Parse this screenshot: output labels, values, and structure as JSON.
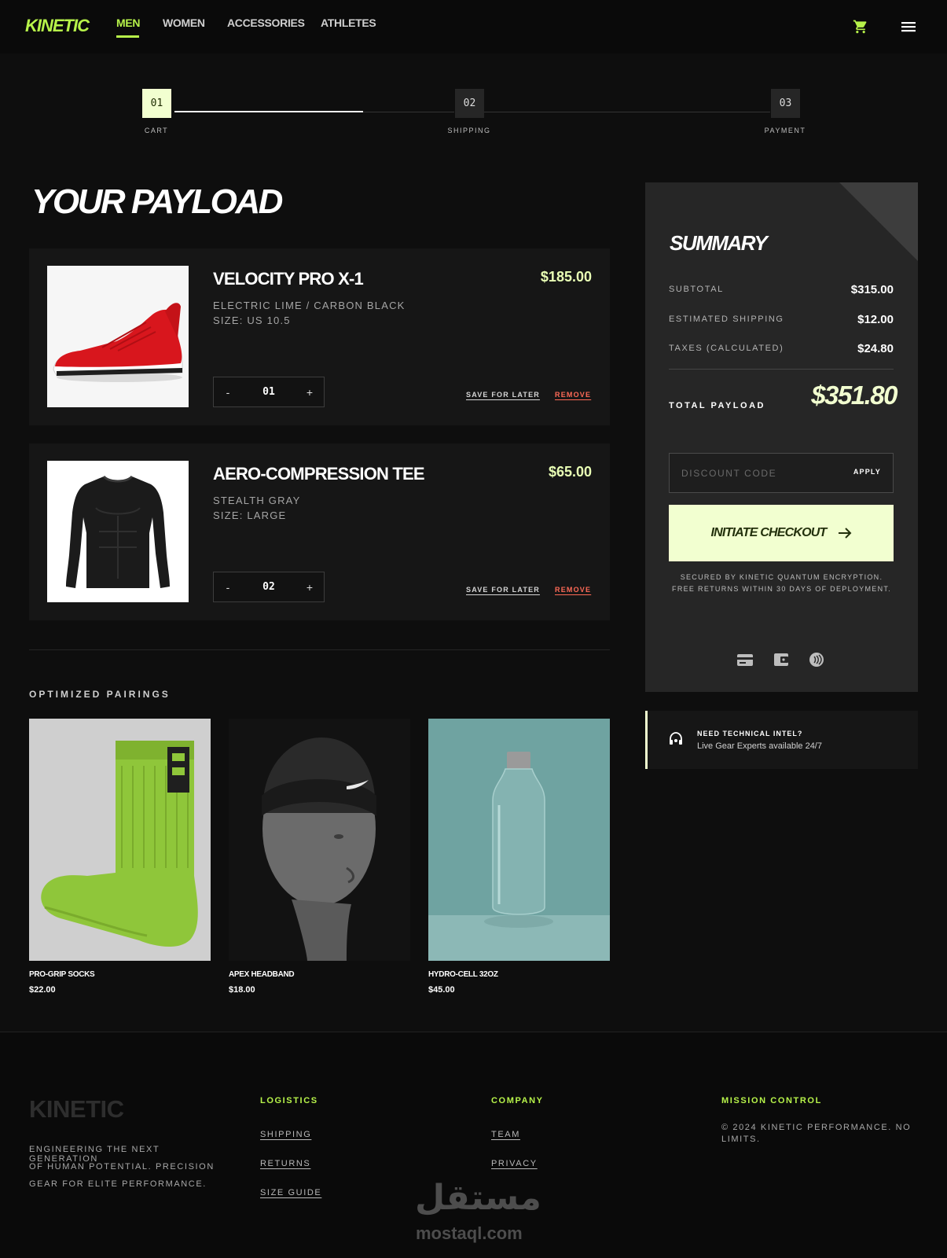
{
  "nav": {
    "logo": "KINETIC",
    "links": [
      "MEN",
      "WOMEN",
      "ACCESSORIES",
      "ATHLETES"
    ],
    "active": "MEN",
    "icons": [
      "cart-icon",
      "menu-icon"
    ],
    "accent": "#b7f34a"
  },
  "stepper": {
    "steps": [
      {
        "num": "01",
        "label": "CART"
      },
      {
        "num": "02",
        "label": "SHIPPING"
      },
      {
        "num": "03",
        "label": "PAYMENT"
      }
    ],
    "current": 1
  },
  "page_title": "YOUR PAYLOAD",
  "cart": {
    "items": [
      {
        "name": "VELOCITY PRO X-1",
        "variant": "ELECTRIC LIME / CARBON BLACK",
        "size": "SIZE: US 10.5",
        "price": "$185.00",
        "qty": "01",
        "minus": "-",
        "plus": "+",
        "save": "SAVE FOR LATER",
        "remove": "REMOVE",
        "image": "red-running-shoe"
      },
      {
        "name": "AERO-COMPRESSION TEE",
        "variant": "STEALTH GRAY",
        "size": "SIZE: LARGE",
        "price": "$65.00",
        "qty": "02",
        "minus": "-",
        "plus": "+",
        "save": "SAVE FOR LATER",
        "remove": "REMOVE",
        "image": "black-compression-shirt"
      }
    ]
  },
  "pairings": {
    "title": "OPTIMIZED PAIRINGS",
    "items": [
      {
        "name": "PRO-GRIP SOCKS",
        "price": "$22.00",
        "image": "green-sock"
      },
      {
        "name": "APEX HEADBAND",
        "price": "$18.00",
        "image": "headband-mannequin"
      },
      {
        "name": "HYDRO-CELL 32OZ",
        "price": "$45.00",
        "image": "glass-bottle"
      }
    ]
  },
  "summary": {
    "title": "SUMMARY",
    "rows": [
      {
        "label": "SUBTOTAL",
        "value": "$315.00"
      },
      {
        "label": "ESTIMATED SHIPPING",
        "value": "$12.00"
      },
      {
        "label": "TAXES (CALCULATED)",
        "value": "$24.80"
      }
    ],
    "total_label": "TOTAL PAYLOAD",
    "total_value": "$351.80",
    "discount_placeholder": "DISCOUNT CODE",
    "apply": "APPLY",
    "checkout": "INITIATE CHECKOUT",
    "secure_line1": "SECURED BY KINETIC QUANTUM ENCRYPTION.",
    "secure_line2": "FREE RETURNS WITHIN 30 DAYS OF DEPLOYMENT.",
    "payment_icons": [
      "credit-card-icon",
      "wallet-icon",
      "contactless-icon"
    ]
  },
  "help": {
    "title": "NEED TECHNICAL INTEL?",
    "subtitle": "Live Gear Experts available 24/7",
    "icon": "headset-icon"
  },
  "footer": {
    "logo": "KINETIC",
    "blurb_lines": [
      "ENGINEERING THE NEXT GENERATION",
      "OF HUMAN POTENTIAL. PRECISION",
      "GEAR FOR ELITE PERFORMANCE."
    ],
    "columns": [
      {
        "title": "LOGISTICS",
        "links": [
          "SHIPPING",
          "RETURNS",
          "SIZE GUIDE"
        ]
      },
      {
        "title": "COMPANY",
        "links": [
          "TEAM",
          "PRIVACY"
        ]
      },
      {
        "title": "MISSION CONTROL",
        "links": []
      }
    ],
    "copyright_lines": [
      "© 2024 KINETIC PERFORMANCE. NO",
      "LIMITS."
    ]
  },
  "watermark": {
    "arabic": "مستقل",
    "latin": "mostaql.com"
  }
}
